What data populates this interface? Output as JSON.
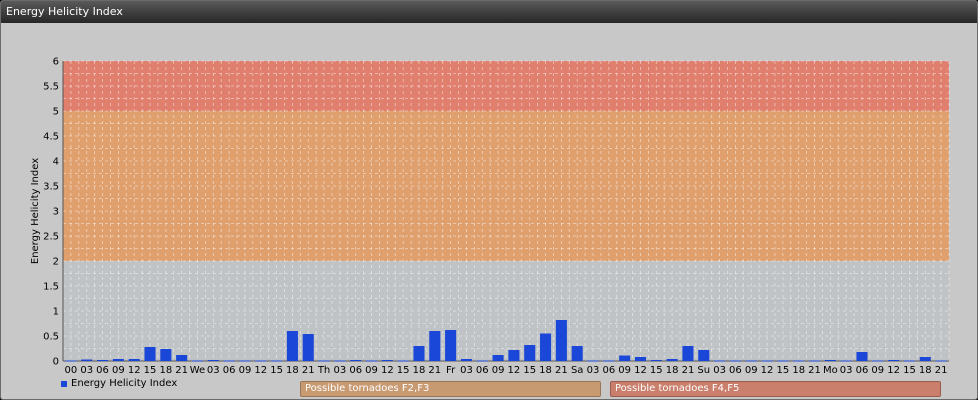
{
  "window": {
    "title": "Energy Helicity Index"
  },
  "chart_data": {
    "type": "bar",
    "title": "",
    "ylabel": "Energy Helicity Index",
    "xlabel": "",
    "ylim": [
      0,
      6
    ],
    "y_ticks": [
      "0",
      "0.5",
      "1",
      "1.5",
      "2",
      "2.5",
      "3",
      "3.5",
      "4",
      "4.5",
      "5",
      "5.5",
      "6"
    ],
    "grid": true,
    "legend_position": "bottom-left",
    "bar_color": "#1a47d8",
    "categories": [
      "00",
      "03",
      "06",
      "09",
      "12",
      "15",
      "18",
      "21",
      "We",
      "03",
      "06",
      "09",
      "12",
      "15",
      "18",
      "21",
      "Th",
      "03",
      "06",
      "09",
      "12",
      "15",
      "18",
      "21",
      "Fr",
      "03",
      "06",
      "09",
      "12",
      "15",
      "18",
      "21",
      "Sa",
      "03",
      "06",
      "09",
      "12",
      "15",
      "18",
      "21",
      "Su",
      "03",
      "06",
      "09",
      "12",
      "15",
      "18",
      "21",
      "Mo",
      "03",
      "06",
      "09",
      "12",
      "15",
      "18",
      "21"
    ],
    "series": [
      {
        "name": "Energy Helicity Index",
        "values": [
          0.01,
          0.03,
          0.02,
          0.04,
          0.04,
          0.28,
          0.24,
          0.12,
          0.01,
          0.02,
          0.01,
          0.01,
          0.01,
          0.01,
          0.6,
          0.54,
          0.01,
          0.01,
          0.02,
          0.01,
          0.02,
          0.01,
          0.3,
          0.6,
          0.62,
          0.04,
          0.01,
          0.12,
          0.22,
          0.32,
          0.55,
          0.82,
          0.3,
          0.01,
          0.01,
          0.11,
          0.08,
          0.02,
          0.04,
          0.3,
          0.22,
          0.01,
          0.01,
          0.01,
          0.01,
          0.01,
          0.01,
          0.01,
          0.02,
          0.01,
          0.18,
          0.01,
          0.02,
          0.01,
          0.08,
          0.01
        ]
      }
    ],
    "bands": [
      {
        "from": 0,
        "to": 2,
        "color": "#bfc3c5",
        "label": ""
      },
      {
        "from": 2,
        "to": 5,
        "color": "#e0a06e",
        "label": "Possible tornadoes F2,F3"
      },
      {
        "from": 5,
        "to": 6,
        "color": "#e07f6e",
        "label": "Possible tornadoes F4,F5"
      }
    ]
  }
}
